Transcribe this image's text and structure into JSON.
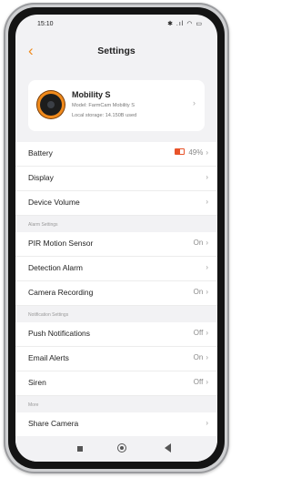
{
  "status_bar": {
    "time": "15:10",
    "icons": "✱ .ıl ◠ ▭"
  },
  "header": {
    "back_icon": "chevron-left-icon",
    "title": "Settings"
  },
  "device": {
    "name": "Mobility S",
    "model": "Model: FarmCam Mobility S",
    "storage": "Local storage: 14.150B used"
  },
  "battery": {
    "label": "Battery",
    "value": "49%",
    "level": 0.49,
    "color": "#e8532a"
  },
  "general": [
    {
      "label": "Display",
      "value": ""
    },
    {
      "label": "Device Volume",
      "value": ""
    }
  ],
  "alarm_section": {
    "title": "Alarm Settings",
    "items": [
      {
        "label": "PIR Motion Sensor",
        "value": "On"
      },
      {
        "label": "Detection Alarm",
        "value": ""
      },
      {
        "label": "Camera Recording",
        "value": "On"
      }
    ]
  },
  "notification_section": {
    "title": "Notification Settings",
    "items": [
      {
        "label": "Push Notifications",
        "value": "Off"
      },
      {
        "label": "Email Alerts",
        "value": "On"
      },
      {
        "label": "Siren",
        "value": "Off"
      }
    ]
  },
  "more_section": {
    "title": "More",
    "items": [
      {
        "label": "Share Camera",
        "value": ""
      }
    ]
  },
  "chevron": "›",
  "accent_color": "#f08a1c"
}
